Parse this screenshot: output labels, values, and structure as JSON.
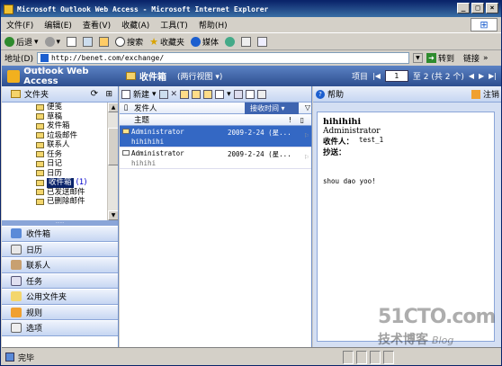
{
  "browser": {
    "title": "Microsoft Outlook Web Access - Microsoft Internet Explorer",
    "window_buttons": [
      "_",
      "□",
      "×"
    ],
    "menu": [
      "文件(F)",
      "编辑(E)",
      "查看(V)",
      "收藏(A)",
      "工具(T)",
      "帮助(H)"
    ],
    "toolbar": {
      "back": "后退",
      "search": "搜索",
      "favorites": "收藏夹",
      "media": "媒体"
    },
    "address_label": "地址(D)",
    "address_value": "http://benet.com/exchange/",
    "go_label": "转到",
    "links_label": "链接"
  },
  "owa": {
    "logo_super": "Microsoft",
    "logo_text": "Outlook Web Access",
    "folder_title": "收件箱",
    "view_selector": "(两行视图 ▾)",
    "pager": {
      "label": "项目",
      "current": "1",
      "of_text": "至 2 (共 2 个)"
    }
  },
  "folders_pane": {
    "header": "文件夹",
    "items": [
      {
        "label": "便笺",
        "count": ""
      },
      {
        "label": "草稿",
        "count": ""
      },
      {
        "label": "发件箱",
        "count": ""
      },
      {
        "label": "垃圾邮件",
        "count": ""
      },
      {
        "label": "联系人",
        "count": ""
      },
      {
        "label": "任务",
        "count": ""
      },
      {
        "label": "日记",
        "count": ""
      },
      {
        "label": "日历",
        "count": ""
      },
      {
        "label": "收件箱",
        "count": "(1)",
        "selected": true
      },
      {
        "label": "已发送邮件",
        "count": ""
      },
      {
        "label": "已删除邮件",
        "count": ""
      }
    ]
  },
  "nav_buttons": [
    "收件箱",
    "日历",
    "联系人",
    "任务",
    "公用文件夹",
    "规则",
    "选项"
  ],
  "list_pane": {
    "new_label": "新建",
    "col_from": "发件人",
    "col_subject": "主题",
    "sort_col": "接收时间",
    "messages": [
      {
        "from": "Administrator",
        "date": "2009-2-24 (星...",
        "subject": "hihihihi",
        "unread": true,
        "selected": true
      },
      {
        "from": "Administrator",
        "date": "2009-2-24 (星...",
        "subject": "hihihi",
        "unread": false,
        "selected": false
      }
    ]
  },
  "reading_pane": {
    "help_label": "帮助",
    "logout_label": "注销",
    "subject": "hihihihi",
    "from": "Administrator",
    "to_label": "收件人：",
    "to_value": "test_1",
    "cc_label": "抄送：",
    "body": "shou dao yoo!"
  },
  "status": {
    "text": "完毕"
  },
  "watermark": {
    "site": "51CTO.com",
    "tagline": "技术博客",
    "blog": "Blog"
  }
}
